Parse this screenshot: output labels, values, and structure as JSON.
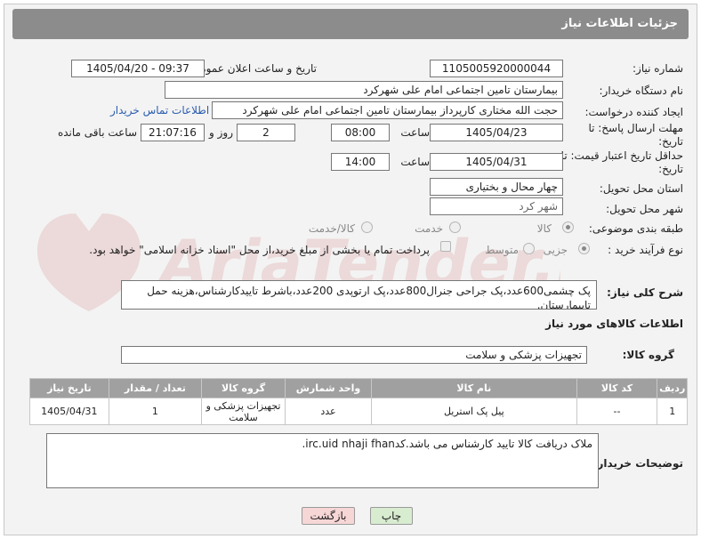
{
  "header": {
    "title": "جزئیات اطلاعات نیاز"
  },
  "labels": {
    "need_number": "شماره نیاز:",
    "announce_datetime": "تاریخ و ساعت اعلان عمومی:",
    "buyer_org": "نام دستگاه خریدار:",
    "creator": "ایجاد کننده درخواست:",
    "reply_deadline": "مهلت ارسال پاسخ: تا تاریخ:",
    "price_validity": "حداقل تاریخ اعتبار قیمت: تا تاریخ:",
    "time": "ساعت",
    "days_and": "روز و",
    "remaining": "ساعت باقی مانده",
    "province": "استان محل تحویل:",
    "city": "شهر محل تحویل:",
    "category": "طبقه بندی موضوعی:",
    "process_type": "نوع فرآیند خرید :",
    "general_desc": "شرح کلی نیاز:",
    "goods_info": "اطلاعات کالاهای مورد نیاز",
    "goods_group": "گروه کالا:",
    "buyer_notes": "توضیحات خریدار:"
  },
  "fields": {
    "need_number": "1105005920000044",
    "announce_datetime": "1405/04/20 - 09:37",
    "buyer_org": "بیمارستان تامین اجتماعی امام علی شهرکرد",
    "creator": "حجت الله مختاری کارپرداز بیمارستان تامین اجتماعی امام علی شهرکرد",
    "contact_link": "اطلاعات تماس خریدار",
    "reply_date": "1405/04/23",
    "reply_time": "08:00",
    "reply_days": "2",
    "reply_remaining": "21:07:16",
    "price_date": "1405/04/31",
    "price_time": "14:00",
    "province": "چهار محال و بختیاری",
    "city": "شهر کرد",
    "general_desc": "پک چشمی600عدد،پک جراحی جنرال800عدد،پک ارتوپدی 200عدد،باشرط تاییدکارشناس،هزینه حمل تابیمارستان.",
    "goods_group": "تجهیزات پزشکی و سلامت",
    "buyer_notes": "ملاک دریافت کالا تایید کارشناس می باشد.کدirc.uid nhaji fhan."
  },
  "category_options": [
    {
      "label": "کالا",
      "selected": true
    },
    {
      "label": "خدمت",
      "selected": false
    },
    {
      "label": "کالا/خدمت",
      "selected": false
    }
  ],
  "process_options": [
    {
      "label": "جزیی",
      "selected": true
    },
    {
      "label": "متوسط",
      "selected": false
    }
  ],
  "partial_payment_text": "پرداخت تمام یا بخشی از مبلغ خرید،از محل \"اسناد خزانه اسلامی\" خواهد بود.",
  "table": {
    "headers": [
      "ردیف",
      "کد کالا",
      "نام کالا",
      "واحد شمارش",
      "گروه کالا",
      "تعداد / مقدار",
      "تاریخ نیاز"
    ],
    "rows": [
      [
        "1",
        "--",
        "پیل پک استریل",
        "عدد",
        "تجهیزات پزشکی و سلامت",
        "1",
        "1405/04/31"
      ]
    ]
  },
  "buttons": {
    "print": "چاپ",
    "back": "بازگشت"
  },
  "colors": {
    "header_bg": "#8c8c8c",
    "table_header_bg": "#a0a0a0",
    "back_button_bg": "#f7d6d6",
    "print_button_bg": "#d8ecd0",
    "link": "#2a5db0"
  }
}
